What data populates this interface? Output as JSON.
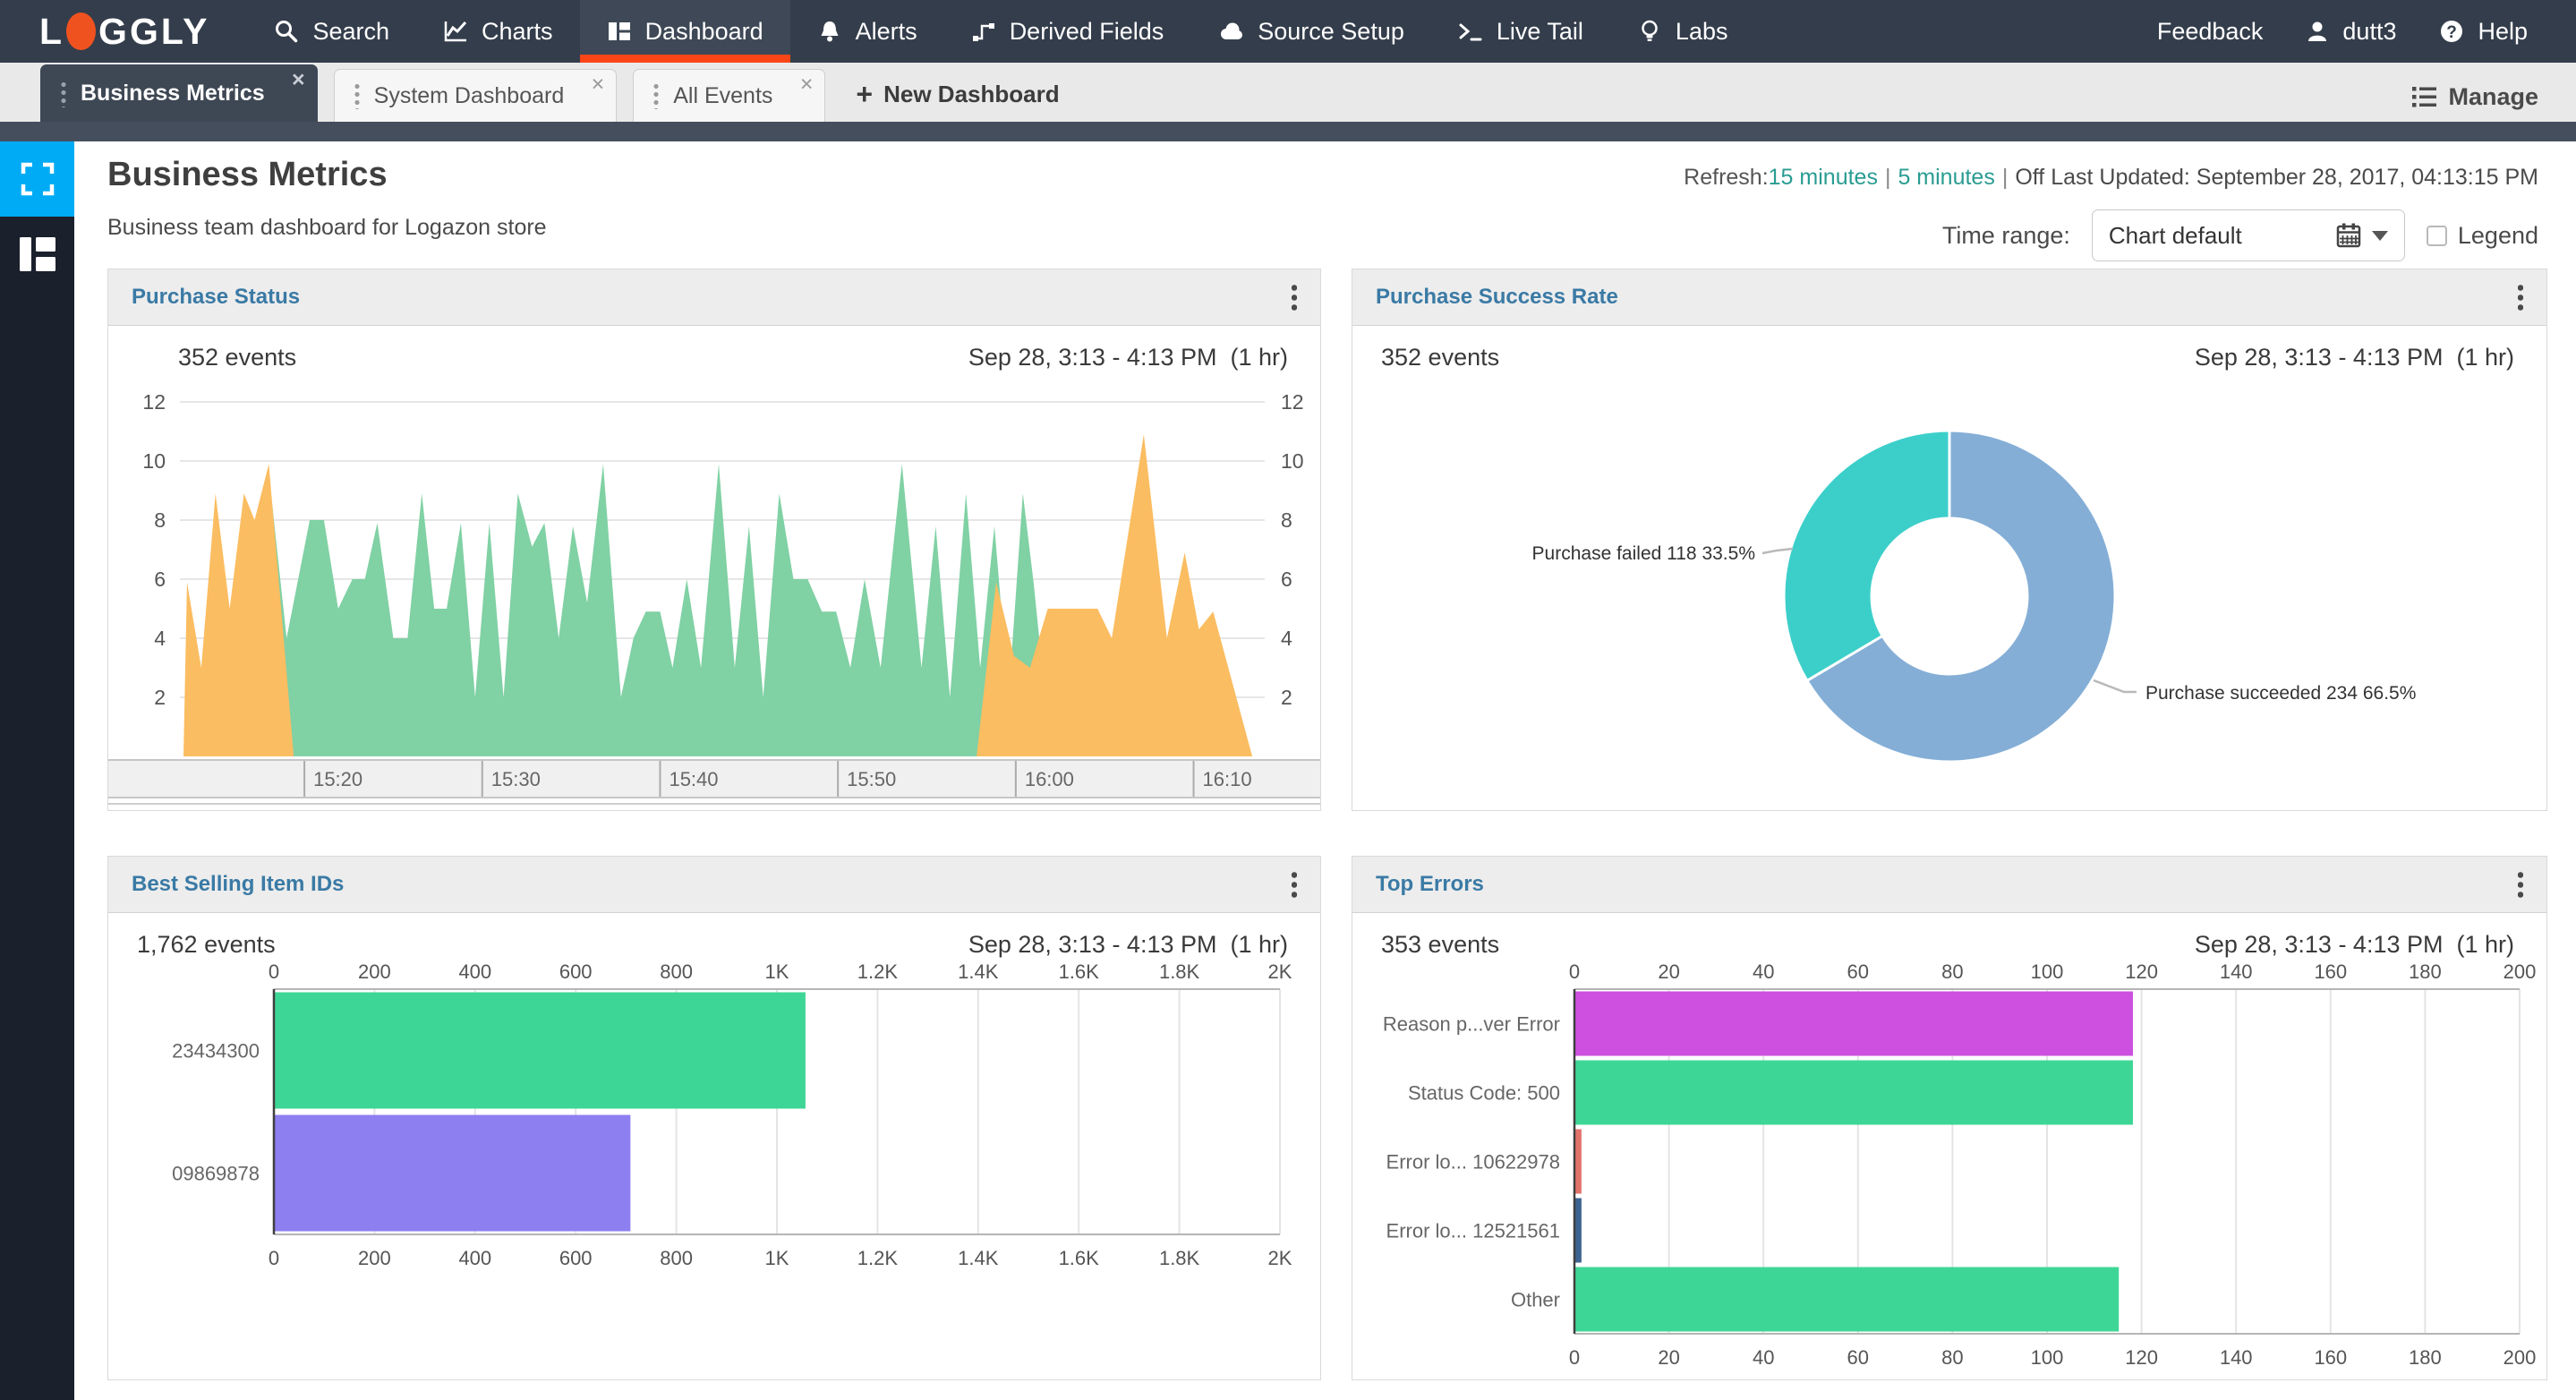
{
  "colors": {
    "nav_bg": "#343d4b",
    "nav_active_underline": "#fa4617",
    "logo_orange": "#f0521f",
    "sidebar_bg": "#1a202c",
    "sidebar_blue_tile": "#00abf5",
    "link_teal": "#299c92",
    "panel_title_blue": "#3a7aa5",
    "panel_header_bg": "#ededed",
    "area_green": "#80d1a4",
    "area_orange": "#fbbd61",
    "donut_blue": "#84aed6",
    "donut_teal": "#3ccfca",
    "bar_green": "#3ed696",
    "bar_purple": "#8d7ff0",
    "bar_magenta": "#cd50e0",
    "bar_salmon": "#e2736b",
    "bar_darkblue": "#3d6491"
  },
  "nav": {
    "logo_l": "L",
    "logo_rest": "GGLY",
    "items": [
      {
        "label": "Search"
      },
      {
        "label": "Charts"
      },
      {
        "label": "Dashboard"
      },
      {
        "label": "Alerts"
      },
      {
        "label": "Derived Fields"
      },
      {
        "label": "Source Setup"
      },
      {
        "label": "Live Tail"
      },
      {
        "label": "Labs"
      }
    ],
    "feedback": "Feedback",
    "user": "dutt3",
    "help": "Help"
  },
  "tabs": {
    "items": [
      {
        "label": "Business Metrics"
      },
      {
        "label": "System Dashboard"
      },
      {
        "label": "All Events"
      }
    ],
    "close": "×",
    "plus": "+",
    "new_label": "New Dashboard",
    "manage": "Manage"
  },
  "header": {
    "title": "Business Metrics",
    "subtitle": "Business team dashboard for Logazon store",
    "refresh_label": "Refresh:",
    "refresh_15": "15 minutes",
    "refresh_5": "5 minutes",
    "sep": "|",
    "refresh_off": "Off",
    "last_updated": "Last Updated: September 28, 2017, 04:13:15 PM",
    "time_range_label": "Time range:",
    "time_range_value": "Chart default",
    "legend_label": "Legend"
  },
  "chart_data": [
    {
      "type": "area",
      "title": "Purchase Status",
      "events": "352 events",
      "time_range": "Sep 28, 3:13 - 4:13 PM  (1 hr)",
      "x_domain": [
        0,
        61
      ],
      "x_start_time": "15:13",
      "ylim": [
        0,
        12
      ],
      "y_ticks": [
        2,
        4,
        6,
        8,
        10,
        12
      ],
      "x_ticks": [
        {
          "t": 7,
          "label": "15:20"
        },
        {
          "t": 17,
          "label": "15:30"
        },
        {
          "t": 27,
          "label": "15:40"
        },
        {
          "t": 37,
          "label": "15:50"
        },
        {
          "t": 47,
          "label": "16:00"
        },
        {
          "t": 57,
          "label": "16:10"
        }
      ],
      "series": [
        {
          "name": "Purchase succeeded",
          "color": "#80d1a4",
          "segments": [
            [
              [
                4,
                0
              ],
              [
                5,
                9.6
              ],
              [
                6,
                4
              ],
              [
                7.3,
                8
              ],
              [
                8.1,
                8
              ],
              [
                8.9,
                5
              ],
              [
                9.7,
                6
              ],
              [
                10.4,
                6
              ],
              [
                11.1,
                7.9
              ],
              [
                12,
                4
              ],
              [
                12.8,
                4
              ],
              [
                13.6,
                8.9
              ],
              [
                14.3,
                5
              ],
              [
                15,
                5
              ],
              [
                15.8,
                7.9
              ],
              [
                16.6,
                2
              ],
              [
                17.4,
                7.9
              ],
              [
                18.2,
                2
              ],
              [
                19,
                8.9
              ],
              [
                19.8,
                7.1
              ],
              [
                20.5,
                7.9
              ],
              [
                21.3,
                4
              ],
              [
                22.1,
                7.8
              ],
              [
                22.9,
                5.2
              ],
              [
                23.8,
                9.9
              ],
              [
                24.8,
                2
              ],
              [
                25.5,
                4
              ],
              [
                26.2,
                4.9
              ],
              [
                27,
                4.9
              ],
              [
                27.7,
                3
              ],
              [
                28.5,
                6
              ],
              [
                29.3,
                3
              ],
              [
                30.3,
                9.9
              ],
              [
                31.2,
                3
              ],
              [
                32,
                7.8
              ],
              [
                32.8,
                2
              ],
              [
                33.7,
                8.9
              ],
              [
                34.5,
                6
              ],
              [
                35.3,
                6
              ],
              [
                36.1,
                4.9
              ],
              [
                36.9,
                4.9
              ],
              [
                37.7,
                3
              ],
              [
                38.5,
                6
              ],
              [
                39.4,
                3
              ],
              [
                40.6,
                9.9
              ],
              [
                41.7,
                3
              ],
              [
                42.5,
                7.8
              ],
              [
                43.3,
                2
              ],
              [
                44.2,
                8.9
              ],
              [
                45,
                3
              ],
              [
                45.8,
                7.8
              ],
              [
                46.6,
                2
              ],
              [
                47.4,
                8.9
              ],
              [
                48,
                5.9
              ],
              [
                49,
                0
              ]
            ]
          ]
        },
        {
          "name": "Purchase failed",
          "color": "#fbbd61",
          "segments": [
            [
              [
                0.2,
                0
              ],
              [
                0.4,
                5.9
              ],
              [
                1.2,
                3
              ],
              [
                2,
                8.9
              ],
              [
                2.8,
                5
              ],
              [
                3.6,
                8.9
              ],
              [
                4.2,
                8
              ],
              [
                5,
                9.9
              ],
              [
                6.4,
                0
              ]
            ],
            [
              [
                44.8,
                0
              ],
              [
                45.9,
                5.9
              ],
              [
                46.9,
                3.4
              ],
              [
                47.8,
                3
              ],
              [
                48.8,
                5
              ],
              [
                50.2,
                5
              ],
              [
                51.6,
                5
              ],
              [
                52.4,
                4
              ],
              [
                54.2,
                10.9
              ],
              [
                55.5,
                4
              ],
              [
                56.5,
                6.9
              ],
              [
                57.3,
                4.3
              ],
              [
                58.1,
                4.9
              ],
              [
                60.3,
                0
              ]
            ]
          ]
        }
      ]
    },
    {
      "type": "donut",
      "title": "Purchase Success Rate",
      "events": "352 events",
      "time_range": "Sep 28, 3:13 - 4:13 PM  (1 hr)",
      "slices": [
        {
          "label": "Purchase succeeded",
          "value": 234,
          "pct": "66.5%",
          "color": "#84aed6"
        },
        {
          "label": "Purchase failed",
          "value": 118,
          "pct": "33.5%",
          "color": "#3ccfca"
        }
      ]
    },
    {
      "type": "hbar",
      "title": "Best Selling Item IDs",
      "events": "1,762 events",
      "time_range": "Sep 28, 3:13 - 4:13 PM  (1 hr)",
      "xmax": 2000,
      "tick_labels": [
        "0",
        "200",
        "400",
        "600",
        "800",
        "1K",
        "1.2K",
        "1.4K",
        "1.6K",
        "1.8K",
        "2K"
      ],
      "rows": [
        {
          "label": "23434300",
          "value": 1055,
          "color": "#3ed696"
        },
        {
          "label": "09869878",
          "value": 707,
          "color": "#8d7ff0"
        }
      ]
    },
    {
      "type": "hbar",
      "title": "Top Errors",
      "events": "353 events",
      "time_range": "Sep 28, 3:13 - 4:13 PM  (1 hr)",
      "xmax": 200,
      "tick_labels": [
        "0",
        "20",
        "40",
        "60",
        "80",
        "100",
        "120",
        "140",
        "160",
        "180",
        "200"
      ],
      "rows": [
        {
          "label": "Reason p...ver Error",
          "value": 118,
          "color": "#cd50e0"
        },
        {
          "label": "Status Code: 500",
          "value": 118,
          "color": "#3ed696"
        },
        {
          "label": "Error lo... 10622978",
          "value": 1.3,
          "color": "#e2736b"
        },
        {
          "label": "Error lo... 12521561",
          "value": 1.3,
          "color": "#3d6491"
        },
        {
          "label": "Other",
          "value": 115,
          "color": "#3ed696"
        }
      ]
    }
  ]
}
